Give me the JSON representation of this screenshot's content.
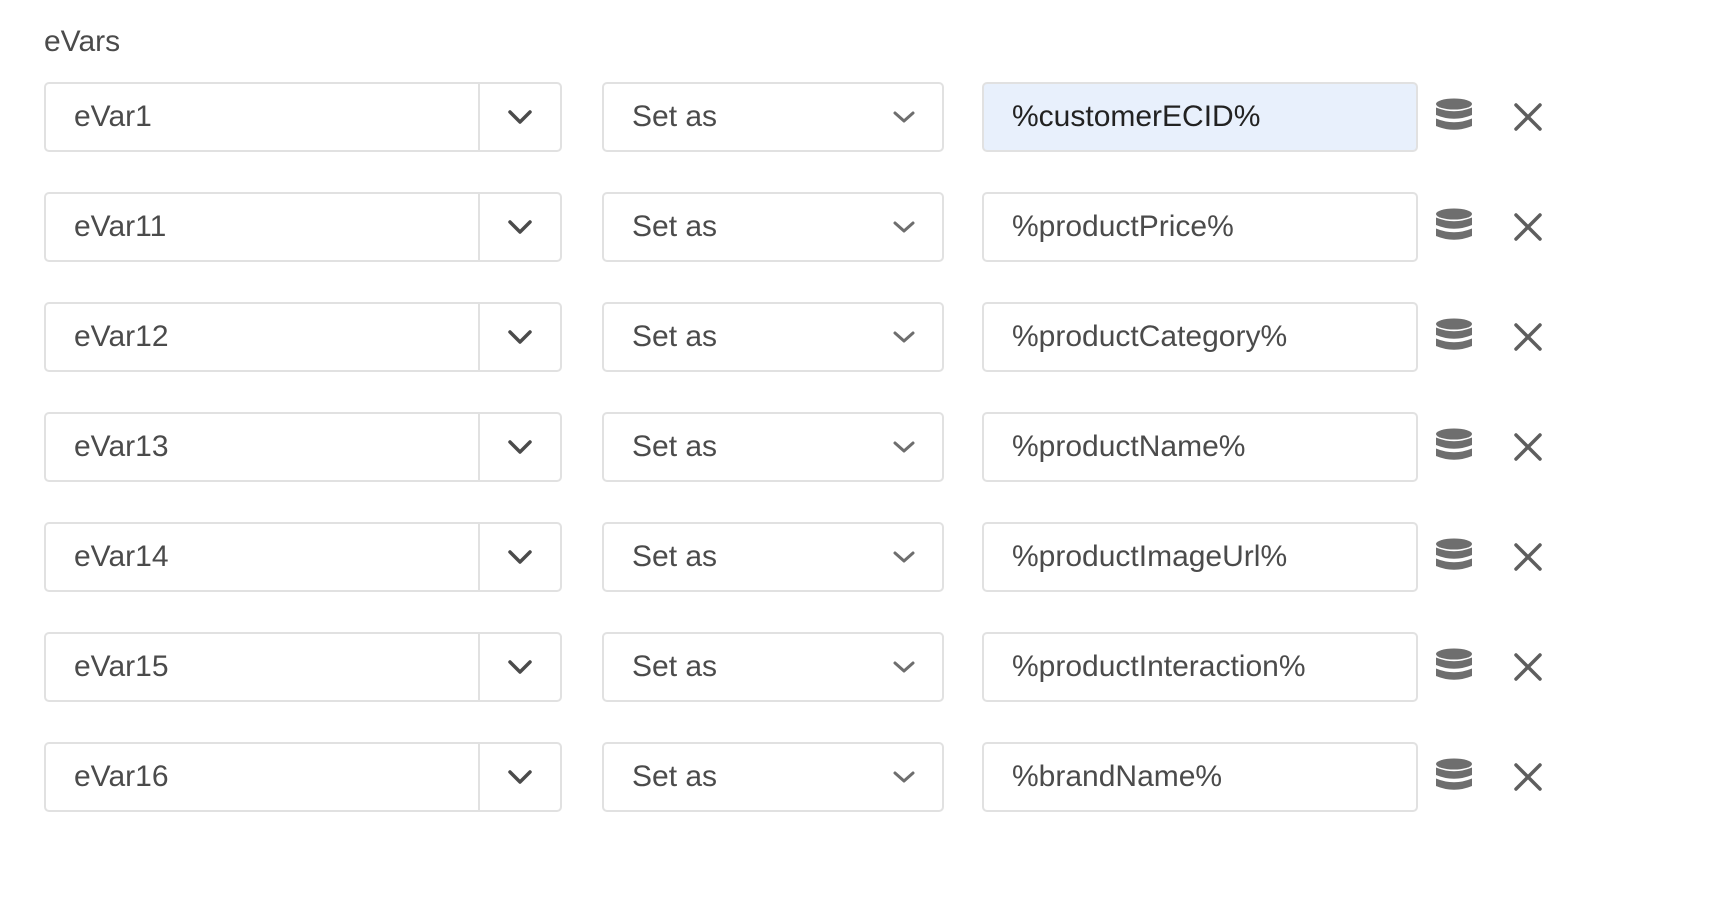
{
  "section": {
    "title": "eVars"
  },
  "rows": [
    {
      "evar": "eVar1",
      "action": "Set as",
      "value": "%customerECID%"
    },
    {
      "evar": "eVar11",
      "action": "Set as",
      "value": "%productPrice%"
    },
    {
      "evar": "eVar12",
      "action": "Set as",
      "value": "%productCategory%"
    },
    {
      "evar": "eVar13",
      "action": "Set as",
      "value": "%productName%"
    },
    {
      "evar": "eVar14",
      "action": "Set as",
      "value": "%productImageUrl%"
    },
    {
      "evar": "eVar15",
      "action": "Set as",
      "value": "%productInteraction%"
    },
    {
      "evar": "eVar16",
      "action": "Set as",
      "value": "%brandName%"
    }
  ],
  "icons": {
    "dropdown": "chevron-down-icon",
    "data_element": "database-icon",
    "remove": "close-icon"
  },
  "colors": {
    "active_field_bg": "#e8f0fc",
    "border": "#e1e1e1",
    "icon": "#6e6e6e"
  }
}
